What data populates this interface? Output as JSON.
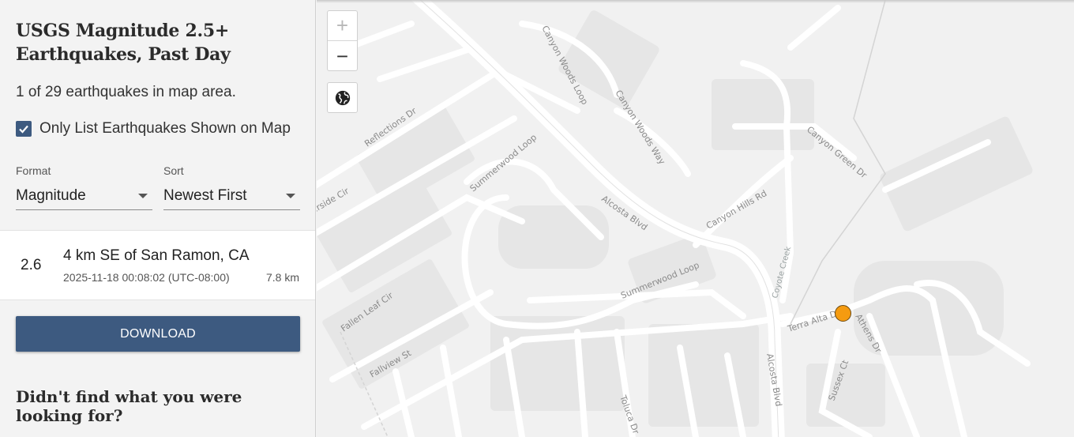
{
  "sidebar": {
    "title": "USGS Magnitude 2.5+ Earthquakes, Past Day",
    "count_text": "1 of 29 earthquakes in map area.",
    "checkbox_label": "Only List Earthquakes Shown on Map",
    "checkbox_checked": true,
    "format": {
      "label": "Format",
      "value": "Magnitude"
    },
    "sort": {
      "label": "Sort",
      "value": "Newest First"
    },
    "earthquakes": [
      {
        "magnitude": "2.6",
        "place": "4 km SE of San Ramon, CA",
        "time": "2025-11-18 00:08:02 (UTC-08:00)",
        "depth": "7.8 km"
      }
    ],
    "download_label": "DOWNLOAD",
    "help_heading": "Didn't find what you were looking for?"
  },
  "map": {
    "zoom_in": "+",
    "zoom_out": "−",
    "layers_icon": "globe-icon",
    "marker_color": "#f59b10",
    "streets": {
      "canyon_woods_loop": "Canyon Woods Loop",
      "canyon_woods_way": "Canyon Woods Way",
      "reflections_dr": "Reflections Dr",
      "summerwood_loop_north": "Summerwood Loop",
      "summerwood_loop_south": "Summerwood Loop",
      "alcosta_blvd_north": "Alcosta Blvd",
      "alcosta_blvd_south": "Alcosta Blvd",
      "canyon_hills_rd": "Canyon Hills Rd",
      "canyon_green_dr": "Canyon Green Dr",
      "coyote_creek": "Coyote Creek",
      "terra_alta_dr": "Terra Alta Dr",
      "athens_dr": "Athens Dr",
      "sussex_ct": "Sussex Ct",
      "fallen_leaf_cir": "Fallen Leaf Cir",
      "fallview_st": "Fallview St",
      "riverside_cir": "erside Cir",
      "toluca_dr": "Toluca Dr"
    }
  }
}
